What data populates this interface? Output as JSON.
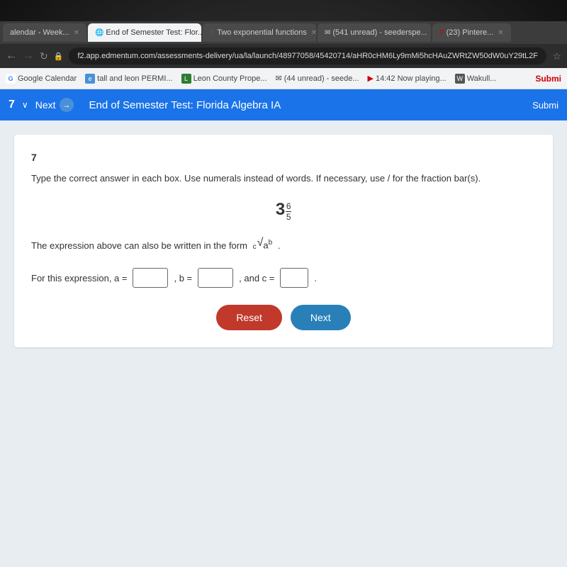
{
  "browser": {
    "tabs": [
      {
        "id": "calendar",
        "label": "alendar - Week...",
        "active": false
      },
      {
        "id": "end-of-semester",
        "label": "End of Semester Test: Flor...",
        "active": true
      },
      {
        "id": "two-exp",
        "label": "Two exponential functions",
        "active": false
      },
      {
        "id": "email",
        "label": "(541 unread) - seederspe...",
        "active": false
      },
      {
        "id": "pinterest",
        "label": "(23) Pintere...",
        "active": false
      }
    ],
    "address": "f2.app.edmentum.com/assessments-delivery/ua/la/launch/48977058/45420714/aHR0cHM6Ly9mMi5hcHAuZWRtZW50dW0uY29tL2Fz",
    "bookmarks": [
      {
        "label": "Google Calendar",
        "icon": "G"
      },
      {
        "label": "tall and leon PERMI...",
        "icon": "e"
      },
      {
        "label": "Leon County Prope...",
        "icon": "L"
      },
      {
        "label": "(44 unread) - seede...",
        "icon": "✉"
      },
      {
        "label": "14:42 Now playing...",
        "icon": "▶"
      },
      {
        "label": "Wakull...",
        "icon": "W"
      }
    ]
  },
  "edmentum_bar": {
    "question_number": "7",
    "next_label": "Next",
    "title": "End of Semester Test: Florida Algebra IA",
    "submit_label": "Submi"
  },
  "question": {
    "number": "7",
    "instructions": "Type the correct answer in each box. Use numerals instead of words. If necessary, use / for the fraction bar(s).",
    "expression": "3",
    "expression_exp_num": "6",
    "expression_exp_den": "5",
    "form_text_before": "The expression above can also be written in the form",
    "form_notation": "ᶜ√aᵇ",
    "form_text_after": ".",
    "answer_prefix": "For this expression, a =",
    "answer_b_label": ", b =",
    "answer_c_label": ", and c =",
    "answer_suffix": ".",
    "placeholder_a": "",
    "placeholder_b": "",
    "placeholder_c": "",
    "reset_label": "Reset",
    "next_label": "Next"
  }
}
